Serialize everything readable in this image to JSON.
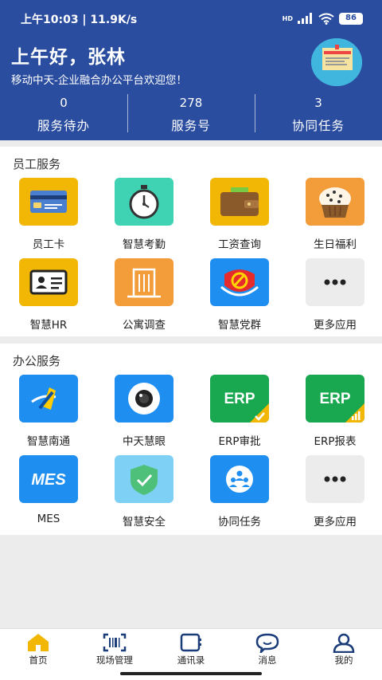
{
  "status_bar": {
    "time_speed": "上午10:03 | 11.9K/s",
    "network": "HD",
    "battery": "86"
  },
  "header": {
    "greeting": "上午好，张林",
    "welcome": "移动中天-企业融合办公平台欢迎您！",
    "stats": [
      {
        "value": "0",
        "label": "服务待办"
      },
      {
        "value": "278",
        "label": "服务号"
      },
      {
        "value": "3",
        "label": "协同任务"
      }
    ]
  },
  "employee_services": {
    "title": "员工服务",
    "items": [
      {
        "label": "员工卡",
        "icon": "id-card-icon"
      },
      {
        "label": "智慧考勤",
        "icon": "stopwatch-icon"
      },
      {
        "label": "工资查询",
        "icon": "wallet-icon"
      },
      {
        "label": "生日福利",
        "icon": "cake-icon"
      },
      {
        "label": "智慧HR",
        "icon": "badge-icon"
      },
      {
        "label": "公寓调查",
        "icon": "building-icon"
      },
      {
        "label": "智慧党群",
        "icon": "party-emblem-icon"
      },
      {
        "label": "更多应用",
        "icon": "more-icon"
      }
    ]
  },
  "office_services": {
    "title": "办公服务",
    "items": [
      {
        "label": "智慧南通",
        "icon": "nantong-logo-icon"
      },
      {
        "label": "中天慧眼",
        "icon": "camera-icon"
      },
      {
        "label": "ERP审批",
        "icon": "erp-approve-icon",
        "text": "ERP"
      },
      {
        "label": "ERP报表",
        "icon": "erp-report-icon",
        "text": "ERP"
      },
      {
        "label": "MES",
        "icon": "mes-icon",
        "text": "MES"
      },
      {
        "label": "智慧安全",
        "icon": "shield-icon"
      },
      {
        "label": "协同任务",
        "icon": "team-icon"
      },
      {
        "label": "更多应用",
        "icon": "more-icon"
      }
    ]
  },
  "bottom_nav": {
    "items": [
      {
        "label": "首页",
        "icon": "home-icon",
        "active": true
      },
      {
        "label": "现场管理",
        "icon": "scan-icon"
      },
      {
        "label": "通讯录",
        "icon": "contacts-icon"
      },
      {
        "label": "消息",
        "icon": "message-icon"
      },
      {
        "label": "我的",
        "icon": "profile-icon"
      }
    ]
  },
  "colors": {
    "header_bg": "#2a4da0",
    "accent_yellow": "#f2b705",
    "accent_teal": "#3fd3b4",
    "accent_orange": "#f39c3a",
    "accent_blue": "#1e8ef0",
    "accent_green": "#19a84f",
    "tile_gray": "#ececec"
  }
}
